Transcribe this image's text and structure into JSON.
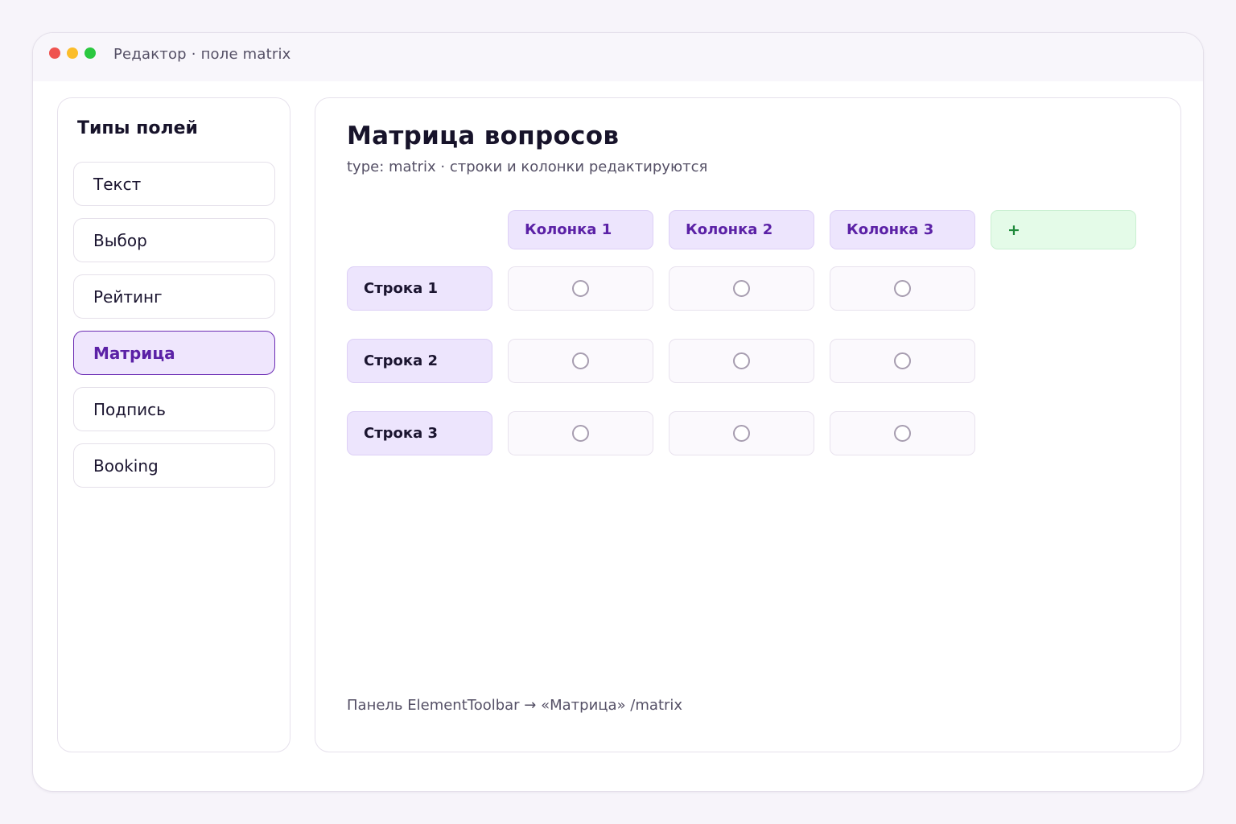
{
  "window": {
    "title": "Редактор · поле matrix"
  },
  "sidebar": {
    "title": "Типы полей",
    "items": [
      {
        "label": "Текст"
      },
      {
        "label": "Выбор"
      },
      {
        "label": "Рейтинг"
      },
      {
        "label": "Матрица",
        "active": true
      },
      {
        "label": "Подпись"
      },
      {
        "label": "Booking"
      }
    ]
  },
  "main": {
    "title": "Матрица вопросов",
    "subtitle": "type: matrix · строки и колонки редактируются",
    "columns": [
      "Колонка 1",
      "Колонка 2",
      "Колонка 3"
    ],
    "add_column_label": "+",
    "rows": [
      "Строка 1",
      "Строка 2",
      "Строка 3"
    ],
    "footer": "Панель ElementToolbar → «Матрица» /matrix"
  },
  "colors": {
    "accent": "#5b21a6",
    "accent_bg": "#ede5fd",
    "add_bg": "#e4fbe8",
    "add_text": "#1f8a3b"
  }
}
